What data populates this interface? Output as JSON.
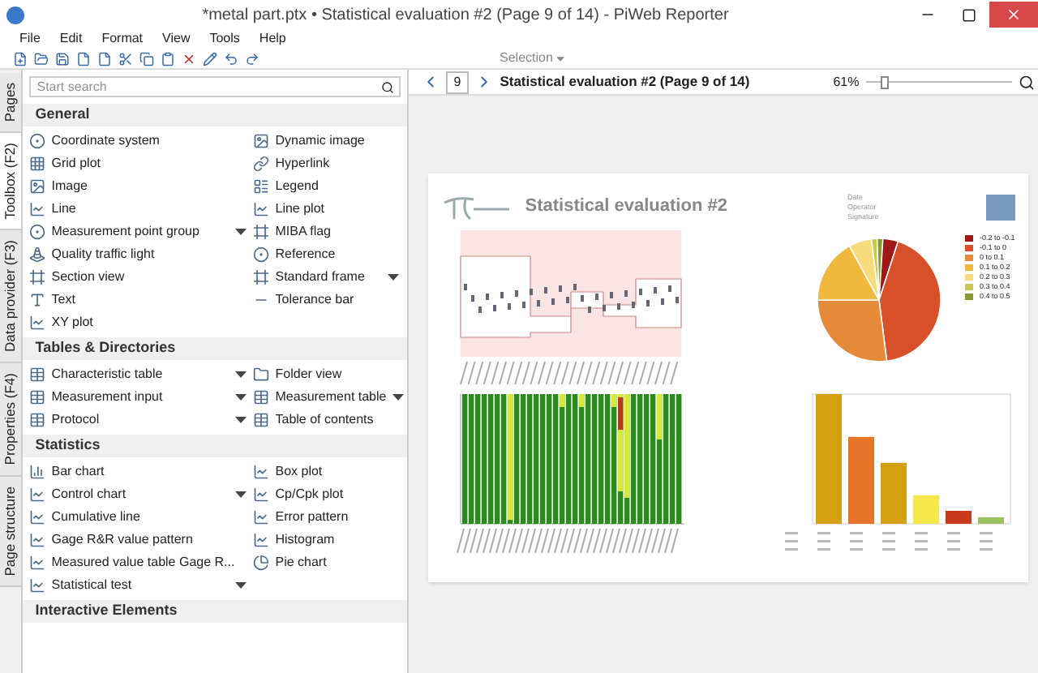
{
  "window": {
    "title": "*metal part.ptx • Statistical evaluation #2 (Page 9 of 14) - PiWeb Reporter"
  },
  "menu": [
    "File",
    "Edit",
    "Format",
    "View",
    "Tools",
    "Help"
  ],
  "toolbar": {
    "selection": "Selection"
  },
  "side_tabs": [
    {
      "label": "Pages",
      "selected": false
    },
    {
      "label": "Toolbox (F2)",
      "selected": true
    },
    {
      "label": "Data provider (F3)",
      "selected": false
    },
    {
      "label": "Properties (F4)",
      "selected": false
    },
    {
      "label": "Page structure",
      "selected": false
    }
  ],
  "search": {
    "placeholder": "Start search"
  },
  "sections": [
    {
      "title": "General",
      "items": [
        {
          "label": "Coordinate system",
          "has_menu": false
        },
        {
          "label": "Dynamic image",
          "has_menu": false
        },
        {
          "label": "Grid plot",
          "has_menu": false
        },
        {
          "label": "Hyperlink",
          "has_menu": false
        },
        {
          "label": "Image",
          "has_menu": false
        },
        {
          "label": "Legend",
          "has_menu": false
        },
        {
          "label": "Line",
          "has_menu": false
        },
        {
          "label": "Line plot",
          "has_menu": false
        },
        {
          "label": "Measurement point group",
          "has_menu": true
        },
        {
          "label": "MIBA flag",
          "has_menu": false
        },
        {
          "label": "Quality traffic light",
          "has_menu": false
        },
        {
          "label": "Reference",
          "has_menu": false
        },
        {
          "label": "Section view",
          "has_menu": false
        },
        {
          "label": "Standard frame",
          "has_menu": true
        },
        {
          "label": "Text",
          "has_menu": false
        },
        {
          "label": "Tolerance bar",
          "has_menu": false
        },
        {
          "label": "XY plot",
          "has_menu": false
        }
      ]
    },
    {
      "title": "Tables & Directories",
      "items": [
        {
          "label": "Characteristic table",
          "has_menu": true
        },
        {
          "label": "Folder view",
          "has_menu": false
        },
        {
          "label": "Measurement input",
          "has_menu": true
        },
        {
          "label": "Measurement table",
          "has_menu": true
        },
        {
          "label": "Protocol",
          "has_menu": true
        },
        {
          "label": "Table of contents",
          "has_menu": false
        }
      ]
    },
    {
      "title": "Statistics",
      "items": [
        {
          "label": "Bar chart",
          "has_menu": false
        },
        {
          "label": "Box plot",
          "has_menu": false
        },
        {
          "label": "Control chart",
          "has_menu": true
        },
        {
          "label": "Cp/Cpk plot",
          "has_menu": false
        },
        {
          "label": "Cumulative line",
          "has_menu": false
        },
        {
          "label": "Error pattern",
          "has_menu": false
        },
        {
          "label": "Gage R&R value pattern",
          "has_menu": false
        },
        {
          "label": "Histogram",
          "has_menu": false
        },
        {
          "label": "Measured value table Gage R...",
          "has_menu": false
        },
        {
          "label": "Pie chart",
          "has_menu": false
        },
        {
          "label": "Statistical test",
          "has_menu": true
        }
      ]
    },
    {
      "title": "Interactive Elements"
    }
  ],
  "nav": {
    "page": "9",
    "title": "Statistical evaluation #2 (Page 9 of 14)",
    "zoom": "61%",
    "zoom_slider": {
      "level": 0.1
    }
  },
  "report": {
    "title": "Statistical evaluation #2",
    "meta": [
      "Date",
      "Operator",
      "Signature"
    ],
    "legend": [
      {
        "label": "-0.2 to -0.1",
        "color": "#a01818"
      },
      {
        "label": "-0.1 to 0",
        "color": "#d8502a"
      },
      {
        "label": "0 to 0.1",
        "color": "#e58a38"
      },
      {
        "label": "0.1 to 0.2",
        "color": "#f0b83c"
      },
      {
        "label": "0.2 to 0.3",
        "color": "#f6dc7a"
      },
      {
        "label": "0.3 to 0.4",
        "color": "#c8c850"
      },
      {
        "label": "0.4 to 0.5",
        "color": "#8a9a30"
      }
    ]
  }
}
